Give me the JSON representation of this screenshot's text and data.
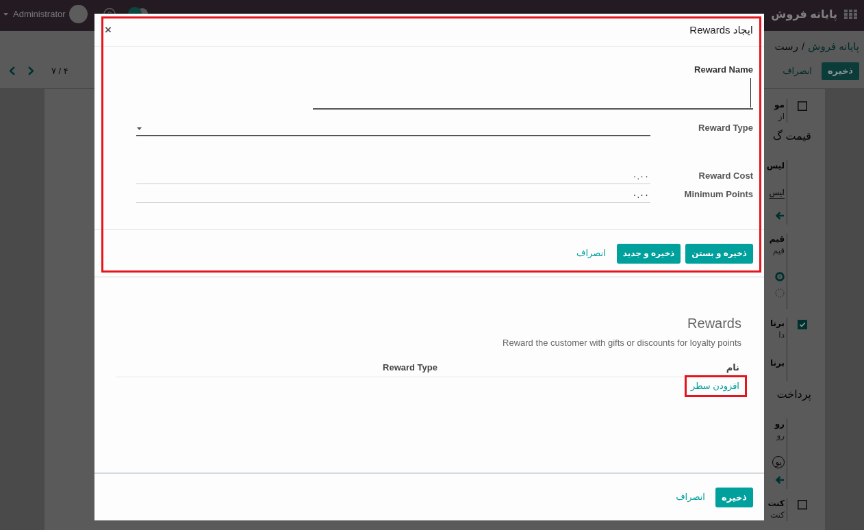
{
  "navbar": {
    "brand": "پایانه فروش",
    "user": "Administrator"
  },
  "breadcrumb": {
    "items": [
      "پایانه فروش",
      "رست"
    ],
    "separator": "/"
  },
  "actions": [
    {
      "label": "ذخیره",
      "kind": "primary"
    },
    {
      "label": "انصراف",
      "kind": "link"
    }
  ],
  "pager": "۷ / ۴",
  "sheet": [
    {
      "kind": "setting",
      "checkbox": {
        "checked": false
      },
      "title": "مو",
      "note": "از"
    },
    {
      "kind": "heading",
      "text": "قیمت گ"
    },
    {
      "kind": "setting",
      "title": "لیس",
      "field": "لیس",
      "arrow": true
    },
    {
      "kind": "setting",
      "title": "قیم",
      "note": "قیم",
      "radios": [
        {
          "selected": true
        },
        {
          "selected": false
        }
      ]
    },
    {
      "kind": "setting",
      "checkbox": {
        "checked": true
      },
      "title": "برنا",
      "note": "دا",
      "title_2": "برنا"
    },
    {
      "kind": "heading",
      "text": "پرداخت"
    },
    {
      "kind": "setting",
      "title": "رو",
      "note": "رو",
      "tag": "یو",
      "arrow": true
    },
    {
      "kind": "setting",
      "checkbox": {
        "checked": false
      },
      "title": "کنت",
      "note": "کنت"
    }
  ],
  "create_dialog": {
    "title": "ایجاد Rewards",
    "close": "×",
    "highlighted": true,
    "title_field": {
      "label": "Reward Name",
      "focused": true
    },
    "fields": [
      {
        "label": "Reward Type",
        "kind": "select"
      },
      {
        "label": "Reward Cost",
        "kind": "number",
        "value": "۰.۰۰"
      },
      {
        "label": "Minimum Points",
        "kind": "number",
        "value": "۰.۰۰"
      }
    ],
    "buttons": [
      {
        "label": "ذخیره و بستن",
        "kind": "primary"
      },
      {
        "label": "ذخیره و جدید",
        "kind": "primary"
      },
      {
        "label": "انصراف",
        "kind": "link"
      }
    ]
  },
  "records_dialog": {
    "section_title": "Rewards",
    "description": "Reward the customer with gifts or discounts for loyalty points",
    "columns": [
      "نام",
      "Reward Type"
    ],
    "add_line": {
      "label": "افزودن سطر",
      "highlighted": true
    },
    "buttons": [
      {
        "label": "ذخیره",
        "kind": "primary"
      },
      {
        "label": "انصراف",
        "kind": "link"
      }
    ]
  }
}
